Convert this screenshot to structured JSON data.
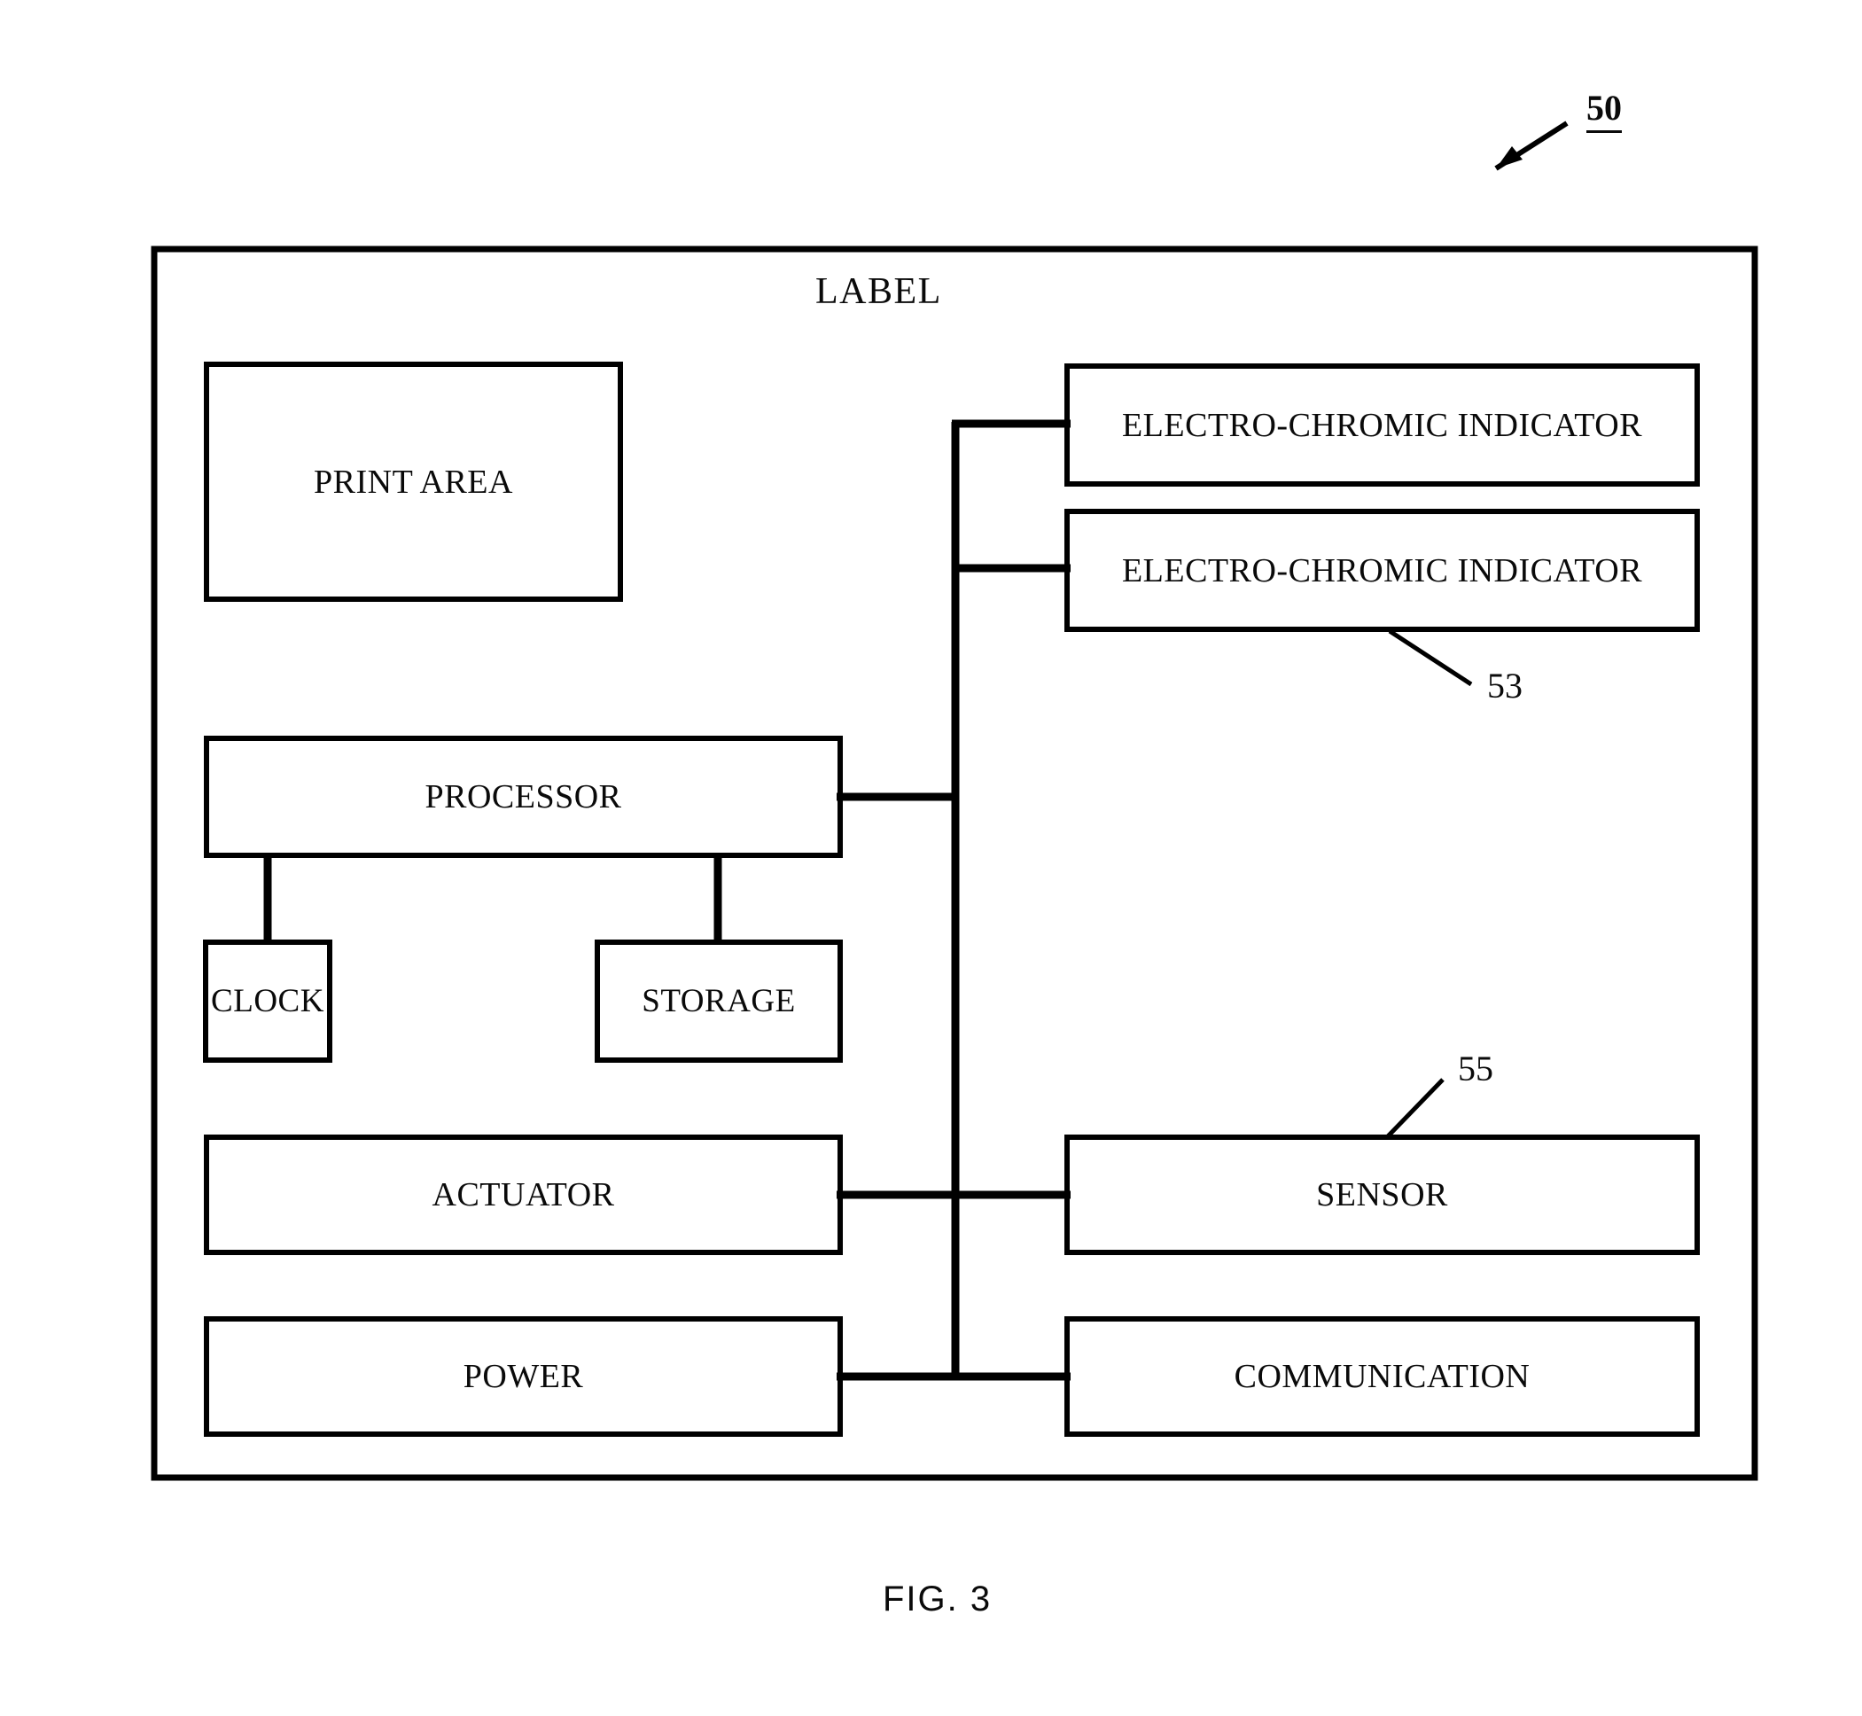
{
  "figure": {
    "caption": "FIG. 3",
    "container_title": "LABEL",
    "container_ref": "50"
  },
  "references": [
    {
      "id": "ref-50",
      "number": "50",
      "underlined": true,
      "target": "label-container"
    },
    {
      "id": "ref-53",
      "number": "53",
      "underlined": false,
      "target": "electro-chromic-indicator-2"
    },
    {
      "id": "ref-55",
      "number": "55",
      "underlined": false,
      "target": "sensor"
    }
  ],
  "blocks": {
    "print_area": "PRINT AREA",
    "processor": "PROCESSOR",
    "clock": "CLOCK",
    "storage": "STORAGE",
    "actuator": "ACTUATOR",
    "power": "POWER",
    "indicator_1": "ELECTRO-CHROMIC INDICATOR",
    "indicator_2": "ELECTRO-CHROMIC INDICATOR",
    "sensor": "SENSOR",
    "communication": "COMMUNICATION"
  },
  "connections": [
    {
      "from": "processor",
      "to": "bus"
    },
    {
      "from": "bus",
      "to": "indicator_1"
    },
    {
      "from": "bus",
      "to": "indicator_2"
    },
    {
      "from": "processor",
      "to": "clock"
    },
    {
      "from": "processor",
      "to": "storage"
    },
    {
      "from": "actuator",
      "to": "sensor"
    },
    {
      "from": "power",
      "to": "communication"
    }
  ],
  "style": {
    "line_color": "#000000",
    "background": "#ffffff"
  }
}
